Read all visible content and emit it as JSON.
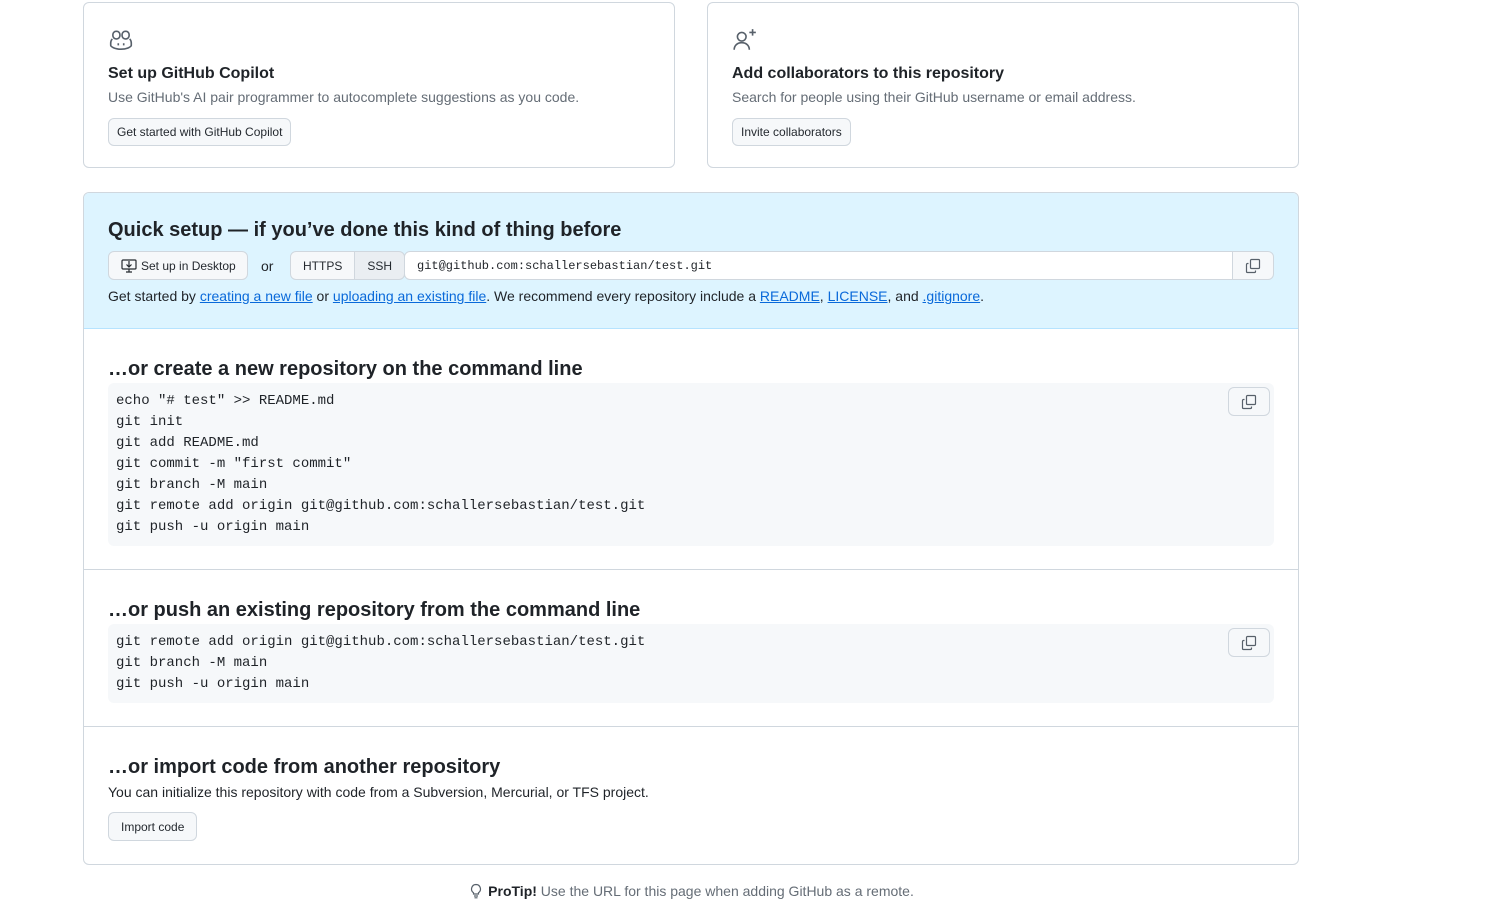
{
  "copilot_card": {
    "icon": "copilot-icon",
    "title": "Set up GitHub Copilot",
    "description": "Use GitHub's AI pair programmer to autocomplete suggestions as you code.",
    "button_label": "Get started with GitHub Copilot"
  },
  "collaborators_card": {
    "icon": "person-add-icon",
    "title": "Add collaborators to this repository",
    "description": "Search for people using their GitHub username or email address.",
    "button_label": "Invite collaborators"
  },
  "quick_setup": {
    "title": "Quick setup — if you’ve done this kind of thing before",
    "desktop_button": "Set up in Desktop",
    "or_text": "or",
    "protocols": [
      "HTTPS",
      "SSH"
    ],
    "selected_protocol": "SSH",
    "clone_url": "git@github.com:schallersebastian/test.git",
    "help": {
      "prefix": "Get started by ",
      "link_new_file": "creating a new file",
      "mid1": " or ",
      "link_upload": "uploading an existing file",
      "mid2": ". We recommend every repository include a ",
      "link_readme": "README",
      "sep1": ", ",
      "link_license": "LICENSE",
      "sep2": ", and ",
      "link_gitignore": ".gitignore",
      "suffix": "."
    }
  },
  "create_section": {
    "title": "…or create a new repository on the command line",
    "lines": [
      "echo \"# test\" >> README.md",
      "git init",
      "git add README.md",
      "git commit -m \"first commit\"",
      "git branch -M main",
      "git remote add origin git@github.com:schallersebastian/test.git",
      "git push -u origin main"
    ]
  },
  "push_section": {
    "title": "…or push an existing repository from the command line",
    "lines": [
      "git remote add origin git@github.com:schallersebastian/test.git",
      "git branch -M main",
      "git push -u origin main"
    ]
  },
  "import_section": {
    "title": "…or import code from another repository",
    "description": "You can initialize this repository with code from a Subversion, Mercurial, or TFS project.",
    "button_label": "Import code"
  },
  "protip": {
    "label": "ProTip!",
    "text": " Use the URL for this page when adding GitHub as a remote."
  }
}
